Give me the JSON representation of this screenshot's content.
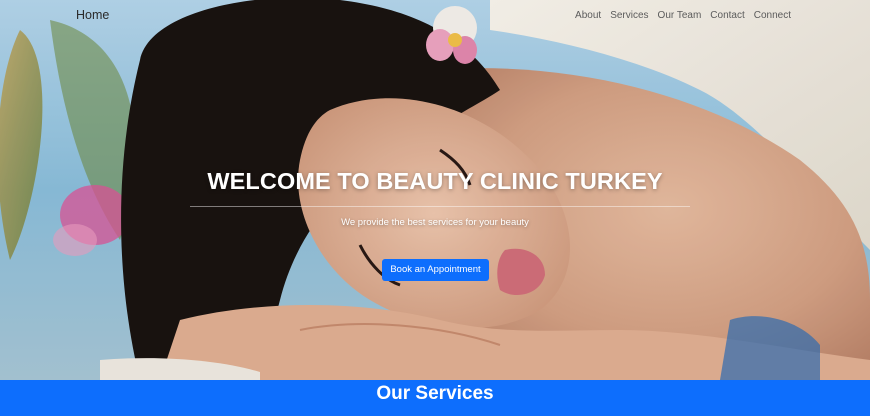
{
  "navbar": {
    "brand": "Home",
    "links": [
      "About",
      "Services",
      "Our Team",
      "Contact",
      "Connect"
    ]
  },
  "hero": {
    "title": "WELCOME TO BEAUTY CLINIC TURKEY",
    "subtitle": "We provide the best services for your beauty",
    "cta_label": "Book an Appointment",
    "image": "spa-woman-relaxing-photo"
  },
  "services": {
    "title": "Our Services"
  },
  "colors": {
    "accent": "#0d6efd",
    "hero_text": "#ffffff",
    "nav_text": "#5b5b5b"
  }
}
